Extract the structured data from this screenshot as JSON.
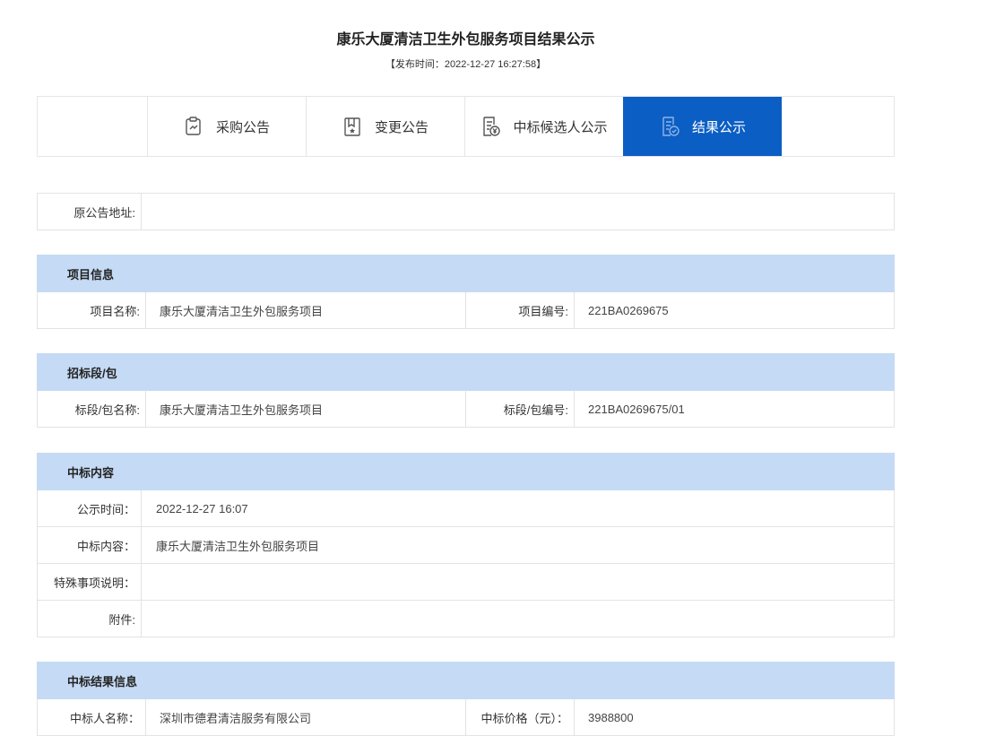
{
  "page": {
    "title": "康乐大厦清洁卫生外包服务项目结果公示",
    "publish_time": "【发布时间：2022-12-27 16:27:58】"
  },
  "tabs": [
    {
      "label": "采购公告",
      "icon": "clipboard-icon",
      "active": false
    },
    {
      "label": "变更公告",
      "icon": "bookmark-icon",
      "active": false
    },
    {
      "label": "中标候选人公示",
      "icon": "document-yen-icon",
      "active": false
    },
    {
      "label": "结果公示",
      "icon": "document-check-icon",
      "active": true
    }
  ],
  "original_notice": {
    "label": "原公告地址:",
    "value": ""
  },
  "project_info": {
    "heading": "项目信息",
    "name_label": "项目名称:",
    "name_value": "康乐大厦清洁卫生外包服务项目",
    "code_label": "项目编号:",
    "code_value": "221BA0269675"
  },
  "lot_info": {
    "heading": "招标段/包",
    "name_label": "标段/包名称:",
    "name_value": "康乐大厦清洁卫生外包服务项目",
    "code_label": "标段/包编号:",
    "code_value": "221BA0269675/01"
  },
  "award_content": {
    "heading": "中标内容",
    "time_label": "公示时间：",
    "time_value": "2022-12-27 16:07",
    "content_label": "中标内容：",
    "content_value": "康乐大厦清洁卫生外包服务项目",
    "special_label": "特殊事项说明：",
    "special_value": "",
    "attach_label": "附件:",
    "attach_value": ""
  },
  "award_result": {
    "heading": "中标结果信息",
    "winner_label": "中标人名称：",
    "winner_value": "深圳市德君清洁服务有限公司",
    "price_label": "中标价格（元）：",
    "price_value": "3988800"
  },
  "colors": {
    "accent": "#0b5ec4",
    "section_header": "#c5daf4"
  }
}
